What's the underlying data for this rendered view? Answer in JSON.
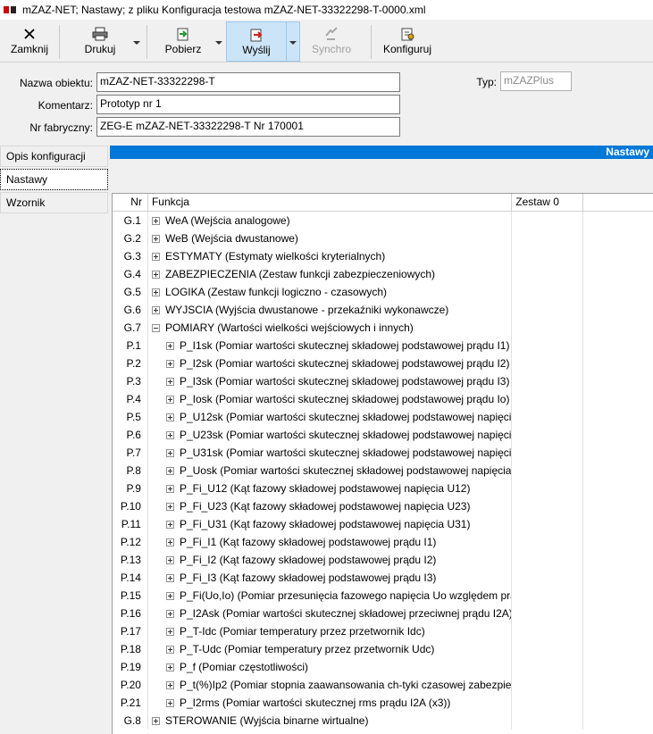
{
  "window": {
    "title": "mZAZ-NET; Nastawy; z pliku Konfiguracja testowa mZAZ-NET-33322298-T-0000.xml"
  },
  "toolbar": {
    "close_label": "Zamknij",
    "print_label": "Drukuj",
    "download_label": "Pobierz",
    "send_label": "Wyślij",
    "synchro_label": "Synchro",
    "configure_label": "Konfiguruj"
  },
  "form": {
    "object_name_label": "Nazwa obiektu:",
    "object_name_value": "mZAZ-NET-33322298-T",
    "comment_label": "Komentarz:",
    "comment_value": "Prototyp nr 1",
    "serial_label": "Nr fabryczny:",
    "serial_value": "ZEG-E  mZAZ-NET-33322298-T  Nr 170001",
    "type_label": "Typ:",
    "type_value": "mZAZPlus"
  },
  "sidenav": {
    "items": [
      {
        "label": "Opis konfiguracji",
        "selected": false
      },
      {
        "label": "Nastawy",
        "selected": true
      },
      {
        "label": "Wzornik",
        "selected": false
      }
    ]
  },
  "panel": {
    "header_label": "Nastawy"
  },
  "grid": {
    "columns": [
      "Nr",
      "Funkcja",
      "Zestaw 0",
      ""
    ],
    "rows": [
      {
        "nr": "G.1",
        "fn": "WeA (Wejścia analogowe)",
        "level": 0,
        "expander": "plus"
      },
      {
        "nr": "G.2",
        "fn": "WeB (Wejścia dwustanowe)",
        "level": 0,
        "expander": "plus"
      },
      {
        "nr": "G.3",
        "fn": "ESTYMATY (Estymaty wielkości kryterialnych)",
        "level": 0,
        "expander": "plus"
      },
      {
        "nr": "G.4",
        "fn": "ZABEZPIECZENIA (Zestaw funkcji zabezpieczeniowych)",
        "level": 0,
        "expander": "plus"
      },
      {
        "nr": "G.5",
        "fn": "LOGIKA (Zestaw funkcji logiczno - czasowych)",
        "level": 0,
        "expander": "plus"
      },
      {
        "nr": "G.6",
        "fn": "WYJSCIA (Wyjścia dwustanowe - przekaźniki wykonawcze)",
        "level": 0,
        "expander": "plus"
      },
      {
        "nr": "G.7",
        "fn": "POMIARY (Wartości wielkości wejściowych i innych)",
        "level": 0,
        "expander": "minus"
      },
      {
        "nr": "P.1",
        "fn": "P_I1sk (Pomiar wartości skutecznej składowej podstawowej prądu I1)",
        "level": 1,
        "expander": "plus"
      },
      {
        "nr": "P.2",
        "fn": "P_I2sk (Pomiar wartości skutecznej składowej podstawowej prądu I2)",
        "level": 1,
        "expander": "plus"
      },
      {
        "nr": "P.3",
        "fn": "P_I3sk (Pomiar wartości skutecznej składowej podstawowej prądu I3)",
        "level": 1,
        "expander": "plus"
      },
      {
        "nr": "P.4",
        "fn": "P_Iosk (Pomiar wartości skutecznej składowej podstawowej prądu  Io)",
        "level": 1,
        "expander": "plus"
      },
      {
        "nr": "P.5",
        "fn": "P_U12sk (Pomiar wartości skutecznej składowej podstawowej napięcia",
        "level": 1,
        "expander": "plus"
      },
      {
        "nr": "P.6",
        "fn": "P_U23sk (Pomiar wartości skutecznej składowej podstawowej napięcia",
        "level": 1,
        "expander": "plus"
      },
      {
        "nr": "P.7",
        "fn": "P_U31sk (Pomiar wartości skutecznej składowej podstawowej napięcia",
        "level": 1,
        "expander": "plus"
      },
      {
        "nr": "P.8",
        "fn": "P_Uosk (Pomiar wartości skutecznej składowej podstawowej napięcia U",
        "level": 1,
        "expander": "plus"
      },
      {
        "nr": "P.9",
        "fn": "P_Fi_U12 (Kąt fazowy składowej podstawowej napięcia U12)",
        "level": 1,
        "expander": "plus"
      },
      {
        "nr": "P.10",
        "fn": "P_Fi_U23 (Kąt fazowy składowej podstawowej napięcia U23)",
        "level": 1,
        "expander": "plus"
      },
      {
        "nr": "P.11",
        "fn": "P_Fi_U31 (Kąt fazowy składowej podstawowej napięcia U31)",
        "level": 1,
        "expander": "plus"
      },
      {
        "nr": "P.12",
        "fn": "P_Fi_I1 (Kąt fazowy składowej podstawowej prądu I1)",
        "level": 1,
        "expander": "plus"
      },
      {
        "nr": "P.13",
        "fn": "P_Fi_I2 (Kąt fazowy składowej podstawowej prądu I2)",
        "level": 1,
        "expander": "plus"
      },
      {
        "nr": "P.14",
        "fn": "P_Fi_I3 (Kąt fazowy składowej podstawowej prądu I3)",
        "level": 1,
        "expander": "plus"
      },
      {
        "nr": "P.15",
        "fn": "P_Fi(Uo,Io) (Pomiar przesunięcia fazowego napięcia Uo względem prąc",
        "level": 1,
        "expander": "plus"
      },
      {
        "nr": "P.16",
        "fn": "P_I2Ask (Pomiar wartości skutecznej składowej przeciwnej prądu I2A)",
        "level": 1,
        "expander": "plus"
      },
      {
        "nr": "P.17",
        "fn": "P_T-Idc (Pomiar temperatury przez przetwornik Idc)",
        "level": 1,
        "expander": "plus"
      },
      {
        "nr": "P.18",
        "fn": "P_T-Udc (Pomiar temperatury przez przetwornik Udc)",
        "level": 1,
        "expander": "plus"
      },
      {
        "nr": "P.19",
        "fn": "P_f (Pomiar częstotliwości)",
        "level": 1,
        "expander": "plus"
      },
      {
        "nr": "P.20",
        "fn": "P_t(%)Ip2 (Pomiar stopnia zaawansowania ch-tyki czasowej zabezpiecz",
        "level": 1,
        "expander": "plus"
      },
      {
        "nr": "P.21",
        "fn": "P_I2rms (Pomiar wartości skutecznej rms prądu I2A (x3))",
        "level": 1,
        "expander": "plus"
      },
      {
        "nr": "G.8",
        "fn": "STEROWANIE (Wyjścia binarne wirtualne)",
        "level": 0,
        "expander": "plus"
      }
    ]
  }
}
